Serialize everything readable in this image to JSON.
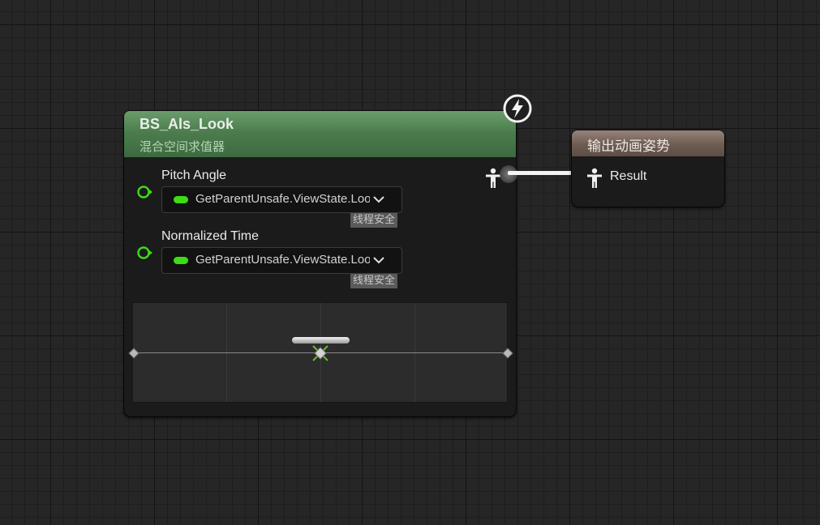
{
  "blendspace_node": {
    "title": "BS_Als_Look",
    "subtitle": "混合空间求值器",
    "pins": [
      {
        "label": "Pitch Angle",
        "binding": "GetParentUnsafe.ViewState.LookPitchAngle",
        "badge": "线程安全"
      },
      {
        "label": "Normalized Time",
        "binding": "GetParentUnsafe.ViewState.LookNormalizedTime",
        "badge": "线程安全"
      }
    ],
    "pin_color": "#3ddc15",
    "header_color": "#4c7d4e",
    "preview": {
      "sample_marker_position": 0.5
    }
  },
  "output_node": {
    "title": "输出动画姿势",
    "pin_label": "Result",
    "header_color": "#6e5c53"
  },
  "icons": {
    "fast_path": "lightning-bolt-icon",
    "pose_pin": "pose-figure-icon",
    "exec_pin": "exec-pin-icon"
  }
}
